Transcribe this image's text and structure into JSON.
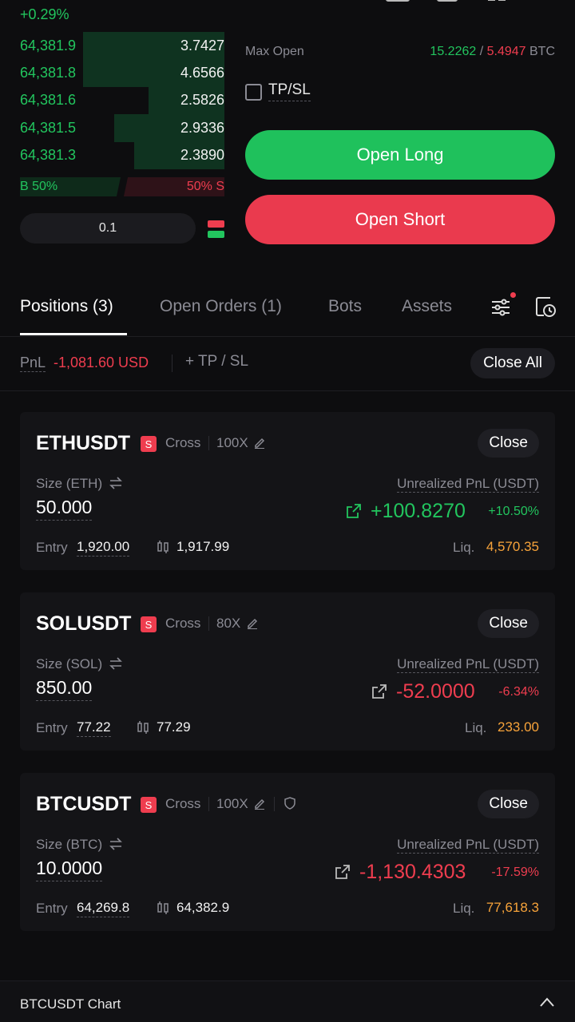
{
  "header": {
    "change_pct": "+0.29%"
  },
  "orderbook": {
    "rows": [
      {
        "price": "64,381.9",
        "qty": "3.7427",
        "depth": 0.69
      },
      {
        "price": "64,381.8",
        "qty": "4.6566",
        "depth": 0.69
      },
      {
        "price": "64,381.6",
        "qty": "2.5826",
        "depth": 0.37
      },
      {
        "price": "64,381.5",
        "qty": "2.9336",
        "depth": 0.54
      },
      {
        "price": "64,381.3",
        "qty": "2.3890",
        "depth": 0.44
      }
    ],
    "buy_ratio": "B 50%",
    "sell_ratio": "50% S",
    "depth_step": "0.1"
  },
  "trade": {
    "max_open_label": "Max Open",
    "max_long": "15.2262",
    "max_sep": " / ",
    "max_short": "5.4947",
    "max_unit": " BTC",
    "tpsl_label": "TP/SL",
    "open_long": "Open Long",
    "open_short": "Open Short"
  },
  "tabs": {
    "positions": "Positions (3)",
    "open_orders": "Open Orders (1)",
    "bots": "Bots",
    "assets": "Assets"
  },
  "pnlbar": {
    "pnl_label": "PnL",
    "pnl_value": "-1,081.60 USD",
    "tpsl": "+ TP / SL",
    "close_all": "Close All"
  },
  "positions": [
    {
      "symbol": "ETHUSDT",
      "side": "S",
      "mode": "Cross",
      "leverage": "100X",
      "close": "Close",
      "size_label": "Size (ETH)",
      "size": "50.000",
      "upnl_label": "Unrealized PnL (USDT)",
      "upnl": "+100.8270",
      "upnl_pct": "+10.50%",
      "entry_label": "Entry",
      "entry": "1,920.00",
      "mark": "1,917.99",
      "liq_label": "Liq.",
      "liq": "4,570.35"
    },
    {
      "symbol": "SOLUSDT",
      "side": "S",
      "mode": "Cross",
      "leverage": "80X",
      "close": "Close",
      "size_label": "Size (SOL)",
      "size": "850.00",
      "upnl_label": "Unrealized PnL (USDT)",
      "upnl": "-52.0000",
      "upnl_pct": "-6.34%",
      "entry_label": "Entry",
      "entry": "77.22",
      "mark": "77.29",
      "liq_label": "Liq.",
      "liq": "233.00"
    },
    {
      "symbol": "BTCUSDT",
      "side": "S",
      "mode": "Cross",
      "leverage": "100X",
      "close": "Close",
      "size_label": "Size (BTC)",
      "size": "10.0000",
      "upnl_label": "Unrealized PnL (USDT)",
      "upnl": "-1,130.4303",
      "upnl_pct": "-17.59%",
      "entry_label": "Entry",
      "entry": "64,269.8",
      "mark": "64,382.9",
      "liq_label": "Liq.",
      "liq": "77,618.3"
    }
  ],
  "bottom": {
    "title": "BTCUSDT Chart"
  },
  "colors": {
    "green": "#22c55e",
    "red": "#ef3d4f",
    "orange": "#f7a33a",
    "background": "#0d0d0f"
  }
}
